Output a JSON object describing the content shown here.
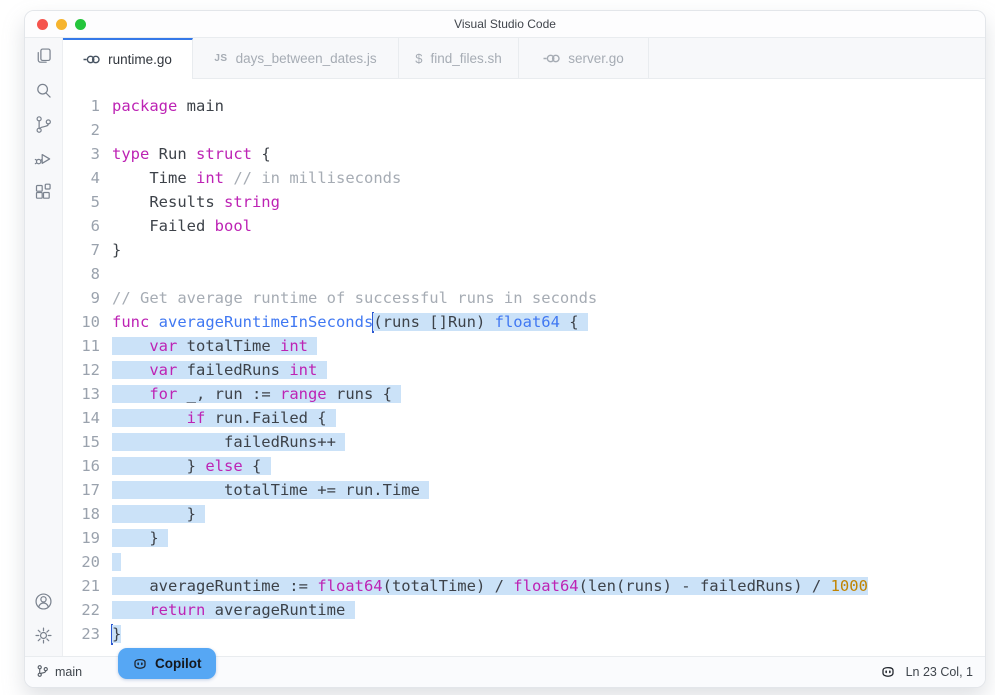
{
  "window": {
    "title": "Visual Studio Code"
  },
  "traffic_lights": [
    "close",
    "minimize",
    "zoom"
  ],
  "tabs": [
    {
      "label": "runtime.go",
      "icon": "go",
      "active": true
    },
    {
      "label": "days_between_dates.js",
      "icon": "js",
      "active": false
    },
    {
      "label": "find_files.sh",
      "icon": "shell",
      "active": false
    },
    {
      "label": "server.go",
      "icon": "go",
      "active": false
    }
  ],
  "activity_bar": {
    "top_items": [
      "explorer",
      "search",
      "source-control",
      "run-debug",
      "extensions"
    ],
    "bottom_items": [
      "account",
      "settings"
    ]
  },
  "editor": {
    "language": "go",
    "lines": [
      {
        "n": 1,
        "tokens": [
          {
            "c": "kw",
            "t": "package"
          },
          {
            "c": "tx",
            "t": " main"
          }
        ]
      },
      {
        "n": 2,
        "tokens": []
      },
      {
        "n": 3,
        "tokens": [
          {
            "c": "kw",
            "t": "type"
          },
          {
            "c": "tx",
            "t": " Run "
          },
          {
            "c": "kw",
            "t": "struct"
          },
          {
            "c": "tx",
            "t": " {"
          }
        ]
      },
      {
        "n": 4,
        "tokens": [
          {
            "c": "tx",
            "t": "    Time "
          },
          {
            "c": "kw",
            "t": "int"
          },
          {
            "c": "tx",
            "t": " "
          },
          {
            "c": "cm",
            "t": "// in milliseconds"
          }
        ]
      },
      {
        "n": 5,
        "tokens": [
          {
            "c": "tx",
            "t": "    Results "
          },
          {
            "c": "kw",
            "t": "string"
          }
        ]
      },
      {
        "n": 6,
        "tokens": [
          {
            "c": "tx",
            "t": "    Failed "
          },
          {
            "c": "kw",
            "t": "bool"
          }
        ]
      },
      {
        "n": 7,
        "tokens": [
          {
            "c": "tx",
            "t": "}"
          }
        ]
      },
      {
        "n": 8,
        "tokens": []
      },
      {
        "n": 9,
        "tokens": [
          {
            "c": "cm",
            "t": "// Get average runtime of successful runs in seconds"
          }
        ]
      },
      {
        "n": 10,
        "tokens": [
          {
            "c": "kw",
            "t": "func"
          },
          {
            "c": "tx",
            "t": " "
          },
          {
            "c": "fn",
            "t": "averageRuntimeInSeconds"
          },
          {
            "caret": 1
          },
          {
            "c": "tx",
            "t": "(runs []Run) ",
            "s": 1
          },
          {
            "c": "fn",
            "t": "float64",
            "s": 1
          },
          {
            "c": "tx",
            "t": " { ",
            "s": 1
          }
        ]
      },
      {
        "n": 11,
        "tokens": [
          {
            "c": "tx",
            "t": "    ",
            "s": 1
          },
          {
            "c": "kw",
            "t": "var",
            "s": 1
          },
          {
            "c": "tx",
            "t": " totalTime ",
            "s": 1
          },
          {
            "c": "kw",
            "t": "int",
            "s": 1
          },
          {
            "c": "tx",
            "t": " ",
            "s": 1
          }
        ]
      },
      {
        "n": 12,
        "tokens": [
          {
            "c": "tx",
            "t": "    ",
            "s": 1
          },
          {
            "c": "kw",
            "t": "var",
            "s": 1
          },
          {
            "c": "tx",
            "t": " failedRuns ",
            "s": 1
          },
          {
            "c": "kw",
            "t": "int",
            "s": 1
          },
          {
            "c": "tx",
            "t": " ",
            "s": 1
          }
        ]
      },
      {
        "n": 13,
        "tokens": [
          {
            "c": "tx",
            "t": "    ",
            "s": 1
          },
          {
            "c": "kw",
            "t": "for",
            "s": 1
          },
          {
            "c": "tx",
            "t": " _, run := ",
            "s": 1
          },
          {
            "c": "kw",
            "t": "range",
            "s": 1
          },
          {
            "c": "tx",
            "t": " runs { ",
            "s": 1
          }
        ]
      },
      {
        "n": 14,
        "tokens": [
          {
            "c": "tx",
            "t": "        ",
            "s": 1
          },
          {
            "c": "kw",
            "t": "if",
            "s": 1
          },
          {
            "c": "tx",
            "t": " run.Failed { ",
            "s": 1
          }
        ]
      },
      {
        "n": 15,
        "tokens": [
          {
            "c": "tx",
            "t": "            failedRuns++ ",
            "s": 1
          }
        ]
      },
      {
        "n": 16,
        "tokens": [
          {
            "c": "tx",
            "t": "        } ",
            "s": 1
          },
          {
            "c": "kw",
            "t": "else",
            "s": 1
          },
          {
            "c": "tx",
            "t": " { ",
            "s": 1
          }
        ]
      },
      {
        "n": 17,
        "tokens": [
          {
            "c": "tx",
            "t": "            totalTime += run.Time ",
            "s": 1
          }
        ]
      },
      {
        "n": 18,
        "tokens": [
          {
            "c": "tx",
            "t": "        } ",
            "s": 1
          }
        ]
      },
      {
        "n": 19,
        "tokens": [
          {
            "c": "tx",
            "t": "    } ",
            "s": 1
          }
        ]
      },
      {
        "n": 20,
        "tokens": [
          {
            "c": "tx",
            "t": " ",
            "s": 1
          }
        ]
      },
      {
        "n": 21,
        "tokens": [
          {
            "c": "tx",
            "t": "    averageRuntime := ",
            "s": 1
          },
          {
            "c": "kw",
            "t": "float64",
            "s": 1
          },
          {
            "c": "tx",
            "t": "(totalTime) / ",
            "s": 1
          },
          {
            "c": "kw",
            "t": "float64",
            "s": 1
          },
          {
            "c": "tx",
            "t": "(len(runs) - failedRuns) / ",
            "s": 1
          },
          {
            "c": "num",
            "t": "1000",
            "s": 1
          }
        ]
      },
      {
        "n": 22,
        "tokens": [
          {
            "c": "tx",
            "t": "    ",
            "s": 1
          },
          {
            "c": "kw",
            "t": "return",
            "s": 1
          },
          {
            "c": "tx",
            "t": " averageRuntime ",
            "s": 1
          }
        ]
      },
      {
        "n": 23,
        "tokens": [
          {
            "caret": 1
          },
          {
            "c": "tx",
            "t": "}",
            "s": 1
          }
        ]
      }
    ]
  },
  "copilot_button": {
    "label": "Copilot"
  },
  "status_bar": {
    "branch": "main",
    "position": "Ln 23 Col, 1"
  },
  "colors": {
    "accent_blue": "#3478e8",
    "selection": "#cbe2f8",
    "keyword": "#bd23b4",
    "function_blue": "#4078f2",
    "number_orange": "#c18401",
    "comment_gray": "#a6acb4",
    "text": "#3d4249",
    "copilot_button_bg": "#56a7f4",
    "traffic_red": "#f5544d",
    "traffic_yellow": "#f6b42e",
    "traffic_green": "#24c53c"
  }
}
